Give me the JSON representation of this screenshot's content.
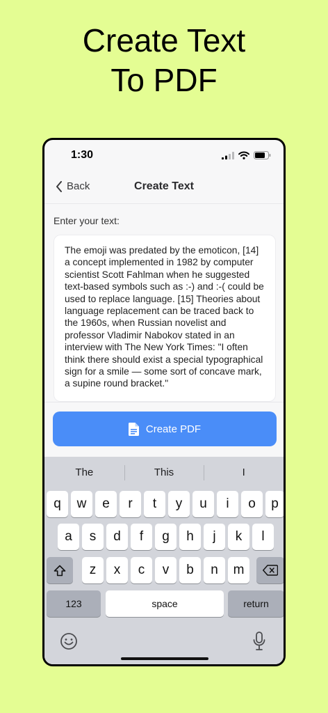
{
  "headline": {
    "line1": "Create Text",
    "line2": "To PDF"
  },
  "status_bar": {
    "time": "1:30"
  },
  "nav": {
    "back_label": "Back",
    "title": "Create Text"
  },
  "editor": {
    "label": "Enter your text:",
    "value": "The emoji was predated by the emoticon, [14] a concept implemented in 1982 by computer scientist Scott Fahlman when he suggested text-based symbols such as :-) and :-( could be used to replace language. [15] Theories about language replacement can be traced back to the 1960s, when Russian novelist and professor Vladimir Nabokov stated in an interview with The New York Times: \"I often think there should exist a special typographical sign for a smile — some sort of concave mark, a supine round bracket.\""
  },
  "create_button": {
    "label": "Create PDF",
    "icon": "document-icon"
  },
  "keyboard": {
    "suggestions": [
      "The",
      "This",
      "I"
    ],
    "row1": [
      "q",
      "w",
      "e",
      "r",
      "t",
      "y",
      "u",
      "i",
      "o",
      "p"
    ],
    "row2": [
      "a",
      "s",
      "d",
      "f",
      "g",
      "h",
      "j",
      "k",
      "l"
    ],
    "row3": [
      "z",
      "x",
      "c",
      "v",
      "b",
      "n",
      "m"
    ],
    "numbers_label": "123",
    "space_label": "space",
    "return_label": "return",
    "icons": {
      "shift": "shift-icon",
      "delete": "delete-icon",
      "emoji": "emoji-icon",
      "mic": "microphone-icon"
    }
  },
  "colors": {
    "background": "#e4fd93",
    "accent": "#4a8df8",
    "keyboard_bg": "#d3d5db"
  }
}
